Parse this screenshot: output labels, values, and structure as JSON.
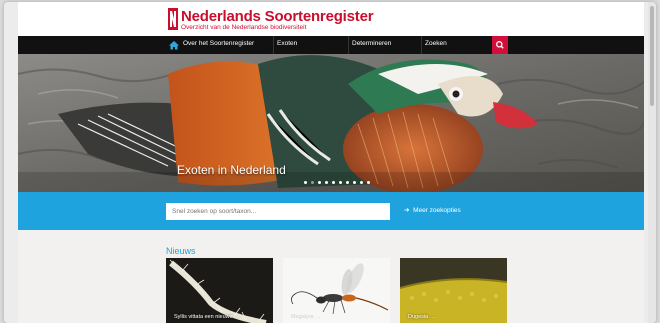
{
  "header": {
    "title": "Nederlands Soortenregister",
    "subtitle": "Overzicht van de Nederlandse biodiversiteit",
    "brand_color": "#c8102e"
  },
  "nav": {
    "home_icon": "home-icon",
    "items": [
      "Over het Soortenregister",
      "Exoten",
      "Determineren",
      "Zoeken"
    ],
    "search_icon": "search-icon"
  },
  "hero": {
    "caption": "Exoten in Nederland",
    "slides_total": 10,
    "active_slide": 1
  },
  "search": {
    "placeholder": "Snel zoeken op soort/taxon...",
    "more_label": "Meer zoekopties",
    "band_color": "#1fa3de"
  },
  "news": {
    "title": "Nieuws",
    "cards": [
      {
        "caption": "Syllis vittata een nieuwe …"
      },
      {
        "caption": "Megalyra …"
      },
      {
        "caption": "Dugesia …"
      }
    ]
  }
}
